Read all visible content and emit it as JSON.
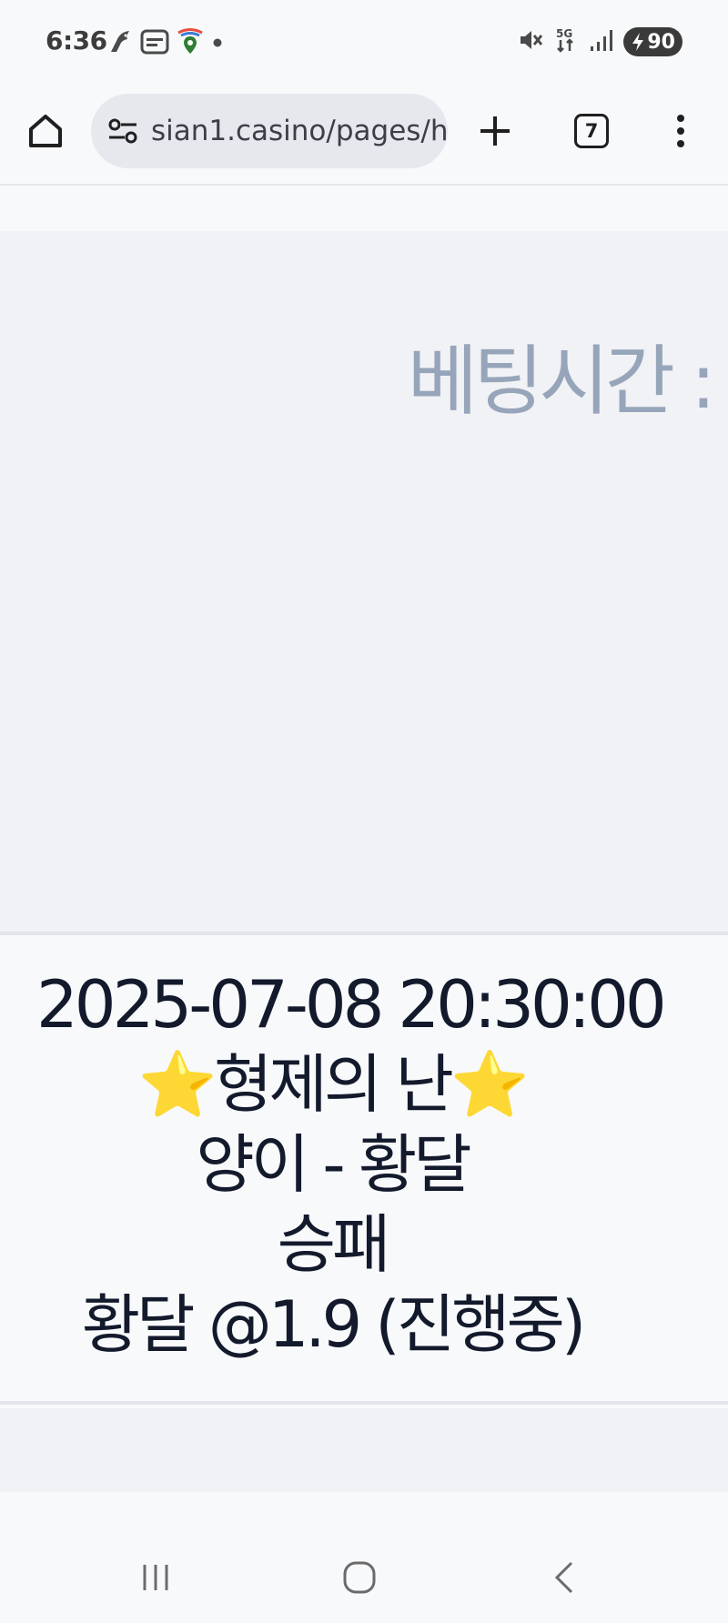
{
  "status_bar": {
    "time": "6:36",
    "left_icons": [
      "bird-app-icon",
      "news-app-icon",
      "maps-app-icon",
      "notification-dot-icon"
    ],
    "right_icons": [
      "mute-icon",
      "5g-data-icon",
      "signal-icon"
    ],
    "battery": "90"
  },
  "toolbar": {
    "url": "sian1.casino/pages/h",
    "tab_count": "7"
  },
  "betting": {
    "label": "베팅시간 :"
  },
  "match": {
    "datetime": "2025-07-08 20:30:00",
    "event_title": "⭐형제의 난⭐",
    "teams": "양이 - 황달",
    "market": "승패",
    "selection": "황달 @1.9 (진행중)"
  },
  "colors": {
    "label_muted": "#97a5bb",
    "text_dark": "#131a2c",
    "panel_bg": "#f1f2f5"
  }
}
